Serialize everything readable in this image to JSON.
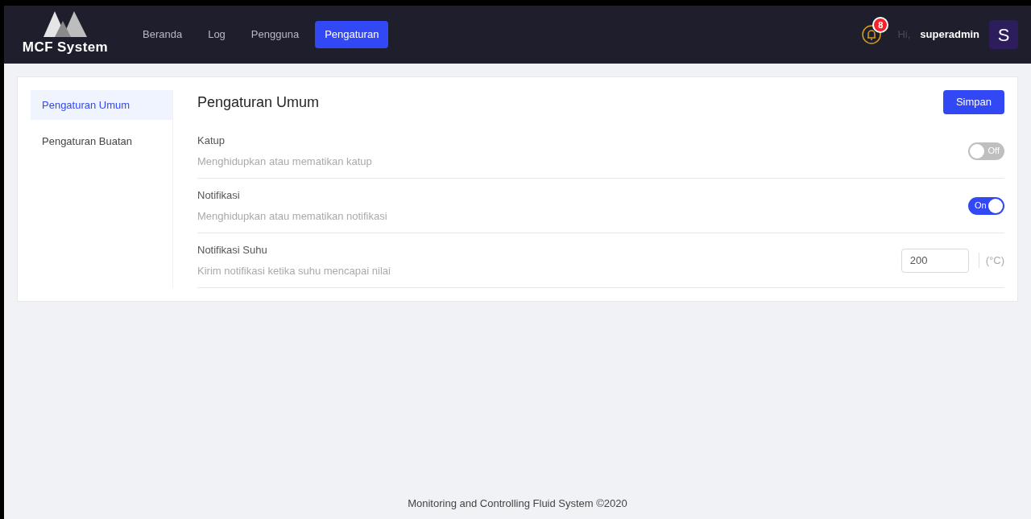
{
  "header": {
    "logo_text": "MCF System",
    "nav": [
      {
        "label": "Beranda",
        "selected": false
      },
      {
        "label": "Log",
        "selected": false
      },
      {
        "label": "Pengguna",
        "selected": false
      },
      {
        "label": "Pengaturan",
        "selected": true
      }
    ],
    "notification_count": "8",
    "greeting": "Hi,",
    "username": "superadmin",
    "avatar_letter": "S"
  },
  "sidebar": {
    "items": [
      {
        "label": "Pengaturan Umum",
        "selected": true
      },
      {
        "label": "Pengaturan Buatan",
        "selected": false
      }
    ]
  },
  "panel": {
    "title": "Pengaturan Umum",
    "save_button": "Simpan",
    "settings": [
      {
        "kind": "toggle",
        "label": "Katup",
        "description": "Menghidupkan atau mematikan katup",
        "on": false,
        "switch_text": "Off"
      },
      {
        "kind": "toggle",
        "label": "Notifikasi",
        "description": "Menghidupkan atau mematikan notifikasi",
        "on": true,
        "switch_text": "On"
      },
      {
        "kind": "number",
        "label": "Notifikasi Suhu",
        "description": "Kirim notifikasi ketika suhu mencapai nilai",
        "value": "200",
        "unit": "(°C)"
      }
    ]
  },
  "footer": "Monitoring and Controlling Fluid System ©2020"
}
